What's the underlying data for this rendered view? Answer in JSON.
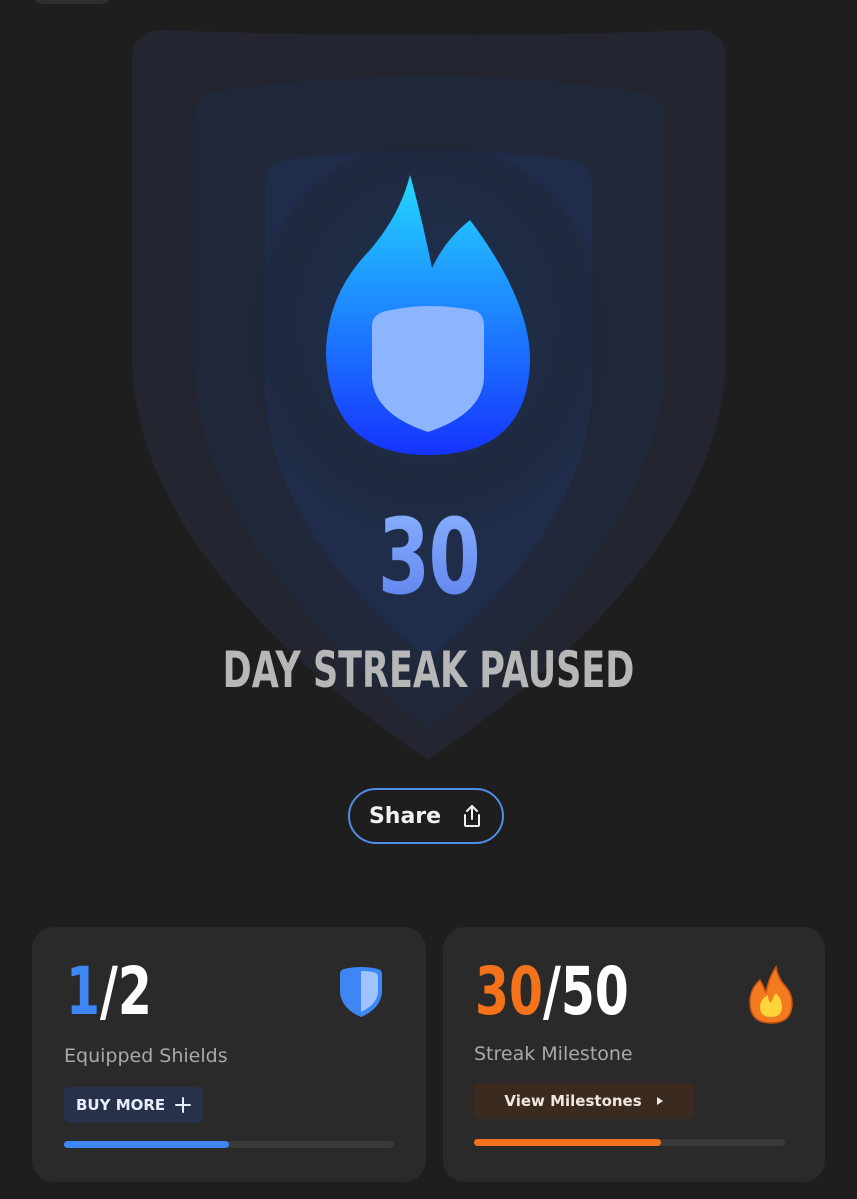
{
  "hero": {
    "streak_count": "30",
    "streak_label": "DAY STREAK PAUSED"
  },
  "share": {
    "label": "Share",
    "icon": "share-icon"
  },
  "shields_card": {
    "current": "1",
    "separator": "/",
    "total": "2",
    "label": "Equipped Shields",
    "button_label": "BUY MORE",
    "button_icon": "plus-icon",
    "icon": "shield-icon",
    "progress_fraction": 0.5,
    "accent_color": "#3e86f3"
  },
  "milestone_card": {
    "current": "30",
    "separator": "/",
    "total": "50",
    "label": "Streak Milestone",
    "button_label": "View Milestones",
    "button_icon": "caret-right-icon",
    "icon": "flame-icon",
    "progress_fraction": 0.6,
    "accent_color": "#f4731a"
  }
}
